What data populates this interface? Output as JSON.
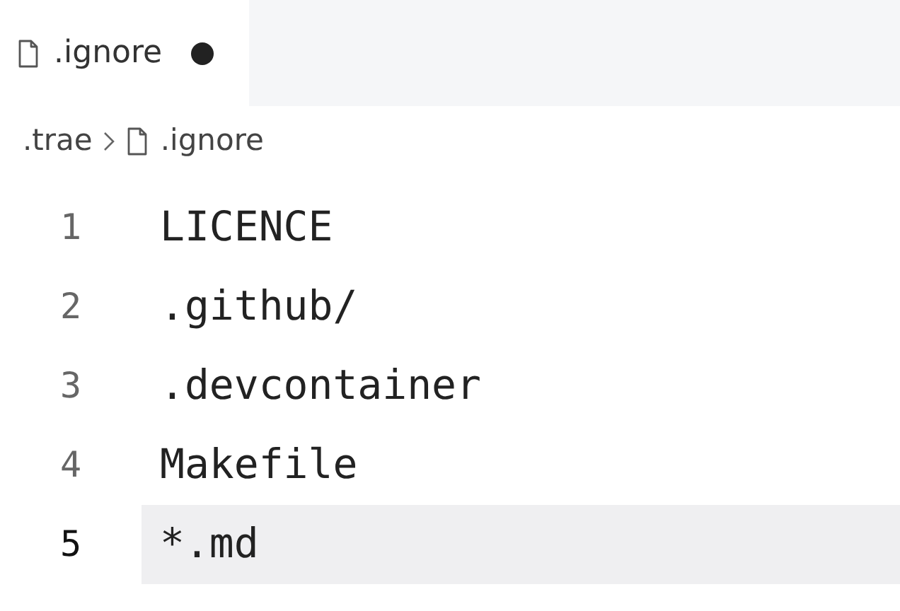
{
  "tabs": [
    {
      "label": ".ignore",
      "modified": true,
      "selected": true
    }
  ],
  "breadcrumb": [
    {
      "label": ".trae",
      "kind": "folder"
    },
    {
      "label": ".ignore",
      "kind": "file"
    }
  ],
  "lines": [
    {
      "number": "1",
      "text": "LICENCE",
      "current": false
    },
    {
      "number": "2",
      "text": ".github/",
      "current": false
    },
    {
      "number": "3",
      "text": ".devcontainer",
      "current": false
    },
    {
      "number": "4",
      "text": "Makefile",
      "current": false
    },
    {
      "number": "5",
      "text": "*.md",
      "current": true
    }
  ]
}
